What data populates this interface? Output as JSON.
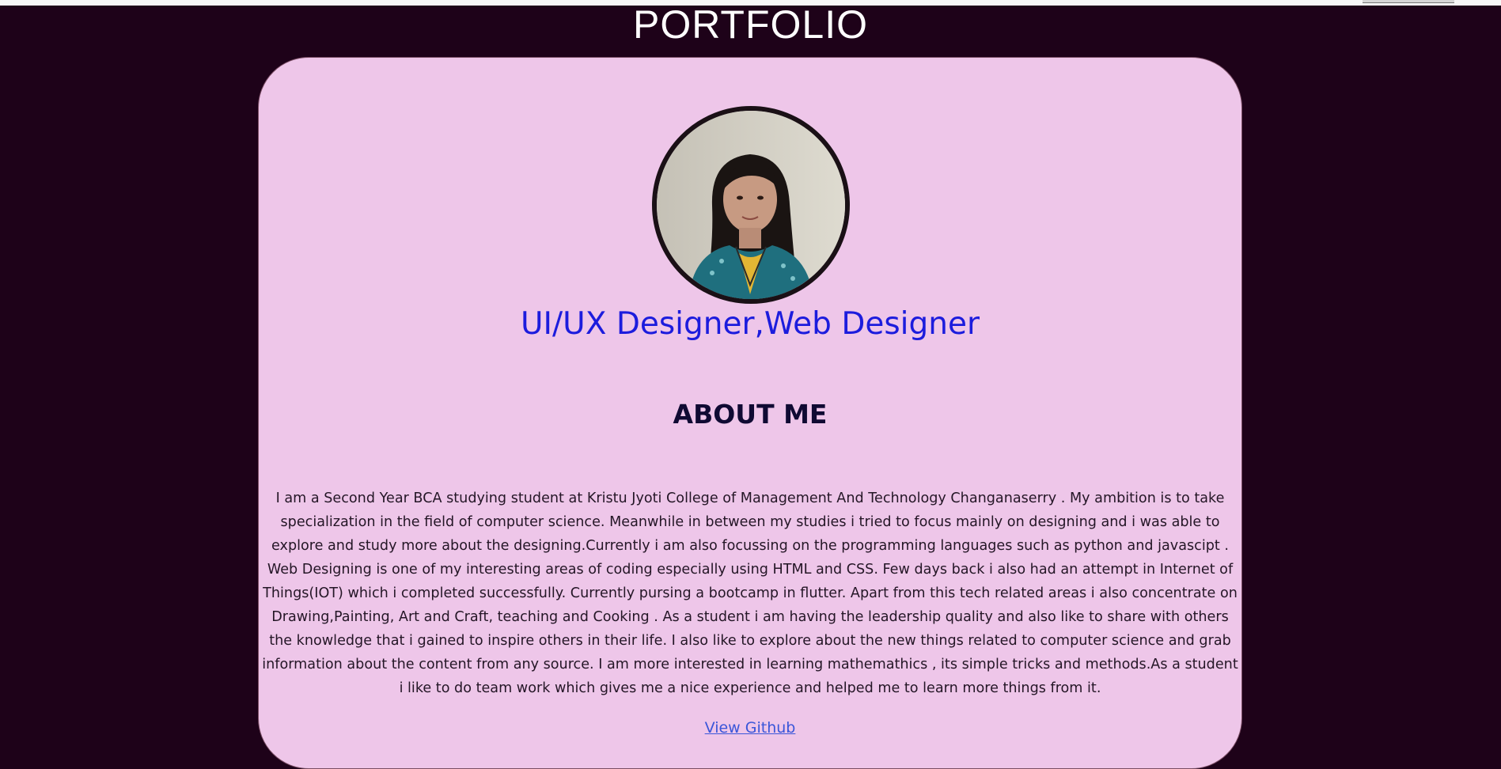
{
  "header": {
    "title": "PORTFOLIO"
  },
  "profile": {
    "role": "UI/UX Designer,Web Designer"
  },
  "about": {
    "heading": "ABOUT ME",
    "text": "I am a Second Year BCA studying student at Kristu Jyoti College of Management And Technology Changanaserry . My ambition is to take specialization in the field of computer science. Meanwhile in between my studies i tried to focus mainly on designing and i was able to explore and study more about the designing.Currently i am also focussing on the programming languages such as python and javascipt . Web Designing is one of my interesting areas of coding especially using HTML and CSS. Few days back i also had an attempt in Internet of Things(IOT) which i completed successfully. Currently pursing a bootcamp in flutter. Apart from this tech related areas i also concentrate on Drawing,Painting, Art and Craft, teaching and Cooking . As a student i am having the leadership quality and also like to share with others the knowledge that i gained to inspire others in their life. I also like to explore about the new things related to computer science and grab information about the content from any source. I am more interested in learning mathemathics , its simple tricks and methods.As a student i like to do team work which gives me a nice experience and helped me to learn more things from it."
  },
  "links": {
    "github_label": "View Github"
  },
  "colors": {
    "background": "#1e0219",
    "card": "#eec6e9",
    "role": "#1c1cdd",
    "heading": "#100a33",
    "link": "#3a56d9"
  }
}
